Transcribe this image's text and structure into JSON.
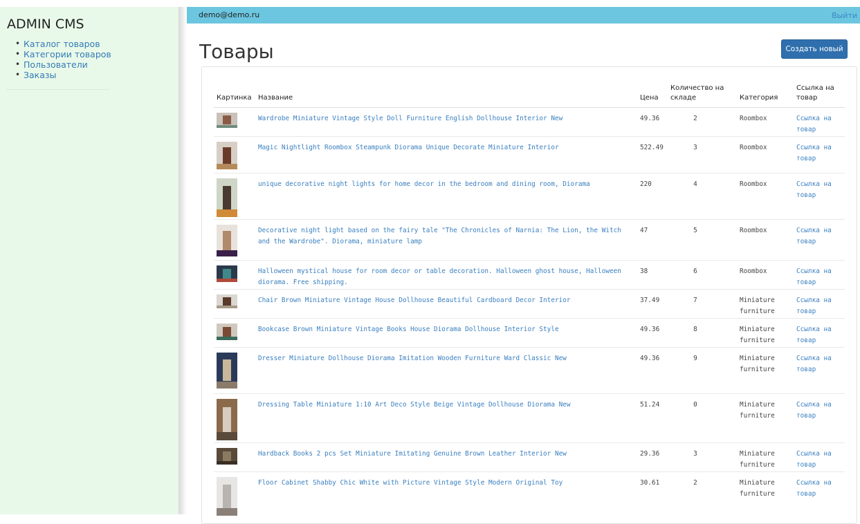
{
  "sidebar": {
    "title": "ADMIN CMS",
    "items": [
      {
        "label": "Каталог товаров"
      },
      {
        "label": "Категории товаров"
      },
      {
        "label": "Пользователи"
      },
      {
        "label": "Заказы"
      }
    ]
  },
  "topbar": {
    "user": "demo@demo.ru",
    "logout": "Выйти"
  },
  "page": {
    "title": "Товары",
    "create_button": "Создать новый"
  },
  "table": {
    "headers": {
      "image": "Картинка",
      "name": "Название",
      "price": "Цена",
      "stock": "Количество на складе",
      "category": "Категория",
      "link": "Ссылка на товар"
    },
    "rows": [
      {
        "name": "Wardrobe Miniature Vintage Style Doll Furniture English Dollhouse Interior New",
        "price": "49.36",
        "stock": "2",
        "category": "Roombox",
        "link": "Ссылка на товар",
        "thumb_colors": [
          "#c9c2b8",
          "#8a5a46",
          "#6f8a7c"
        ]
      },
      {
        "name": "Magic Nightlight Roombox Steampunk Diorama Unique Decorate Miniature Interior",
        "price": "522.49",
        "stock": "3",
        "category": "Roombox",
        "link": "Ссылка на товар",
        "thumb_colors": [
          "#d7cfc6",
          "#6b3b2a",
          "#b58a5a"
        ]
      },
      {
        "name": "unique decorative night lights for home decor in the bedroom and dining room, Diorama",
        "price": "220",
        "stock": "4",
        "category": "Roombox",
        "link": "Ссылка на товар",
        "thumb_colors": [
          "#cfd6c6",
          "#4a3b32",
          "#d08a38"
        ]
      },
      {
        "name": "Decorative night light based on the fairy tale \"The Chronicles of Narnia: The Lion, the Witch and the Wardrobe\". Diorama, miniature lamp",
        "price": "47",
        "stock": "5",
        "category": "Roombox",
        "link": "Ссылка на товар",
        "thumb_colors": [
          "#e9e2dc",
          "#b08a6a",
          "#3a1f4a"
        ]
      },
      {
        "name": "Halloween mystical house for room decor or table decoration. Halloween ghost house, Halloween diorama. Free shipping.",
        "price": "38",
        "stock": "6",
        "category": "Roombox",
        "link": "Ссылка на товар",
        "thumb_colors": [
          "#2a3a4a",
          "#3e8a8a",
          "#b04a3a"
        ]
      },
      {
        "name": "Chair Brown Miniature Vintage House Dollhouse Beautiful Cardboard Decor Interior",
        "price": "37.49",
        "stock": "7",
        "category": "Miniature furniture",
        "link": "Ссылка на товар",
        "thumb_colors": [
          "#dad6d0",
          "#5a3a2a",
          "#a89a8a"
        ]
      },
      {
        "name": "Bookcase Brown Miniature Vintage Books House Diorama Dollhouse Interior Style",
        "price": "49.36",
        "stock": "8",
        "category": "Miniature furniture",
        "link": "Ссылка на товар",
        "thumb_colors": [
          "#d0c8be",
          "#7a4a32",
          "#3a6a5a"
        ]
      },
      {
        "name": "Dresser Miniature Dollhouse Diorama Imitation Wooden Furniture Ward Classic New",
        "price": "49.36",
        "stock": "9",
        "category": "Miniature furniture",
        "link": "Ссылка на товар",
        "thumb_colors": [
          "#2c3a5a",
          "#c8b89a",
          "#8a7a6a"
        ]
      },
      {
        "name": "Dressing Table Miniature 1:10 Art Deco Style Beige Vintage Dollhouse Diorama New",
        "price": "51.24",
        "stock": "0",
        "category": "Miniature furniture",
        "link": "Ссылка на товар",
        "thumb_colors": [
          "#8a6a4a",
          "#d8ccc0",
          "#5a4a3a"
        ]
      },
      {
        "name": "Hardback Books 2 pcs Set Miniature Imitating Genuine Brown Leather Interior New",
        "price": "29.36",
        "stock": "3",
        "category": "Miniature furniture",
        "link": "Ссылка на товар",
        "thumb_colors": [
          "#5a4a3a",
          "#8a7a60",
          "#3a2e24"
        ]
      },
      {
        "name": "Floor Cabinet Shabby Chic White with Picture Vintage Style Modern Original Toy",
        "price": "30.61",
        "stock": "2",
        "category": "Miniature furniture",
        "link": "Ссылка на товар",
        "thumb_colors": [
          "#e8e6e4",
          "#b8b4b0",
          "#8a8078"
        ]
      }
    ]
  }
}
